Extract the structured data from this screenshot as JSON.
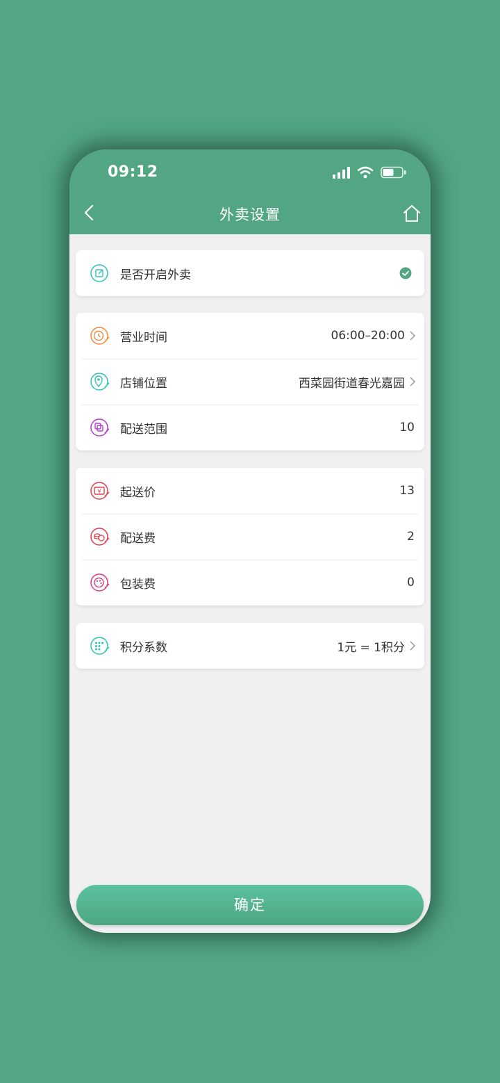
{
  "status_bar": {
    "time": "09:12"
  },
  "nav": {
    "title": "外卖设置"
  },
  "toggle_section": {
    "label": "是否开启外卖",
    "enabled": true,
    "icon": "edit-icon",
    "icon_color": "#2ec3b8"
  },
  "store_section": [
    {
      "label": "营业时间",
      "value": "06:00–20:00",
      "icon": "clock-icon",
      "icon_color": "#f08a3c",
      "chevron": true
    },
    {
      "label": "店铺位置",
      "value": "西菜园街道春光嘉园",
      "icon": "location-icon",
      "icon_color": "#2ec3b8",
      "chevron": true
    },
    {
      "label": "配送范围",
      "value": "10",
      "icon": "range-icon",
      "icon_color": "#b03ccf",
      "chevron": false
    }
  ],
  "price_section": [
    {
      "label": "起送价",
      "value": "13",
      "icon": "price-icon",
      "icon_color": "#e0404c"
    },
    {
      "label": "配送费",
      "value": "2",
      "icon": "fee-icon",
      "icon_color": "#e0404c"
    },
    {
      "label": "包装费",
      "value": "0",
      "icon": "package-icon",
      "icon_color": "#d63c84"
    }
  ],
  "points_section": {
    "label": "积分系数",
    "value": "1元 = 1积分",
    "icon": "points-icon",
    "icon_color": "#2ec3b8"
  },
  "confirm_button": {
    "label": "确定"
  },
  "colors": {
    "brand": "#52a684",
    "check": "#52a684",
    "background": "#f0f0f0"
  }
}
